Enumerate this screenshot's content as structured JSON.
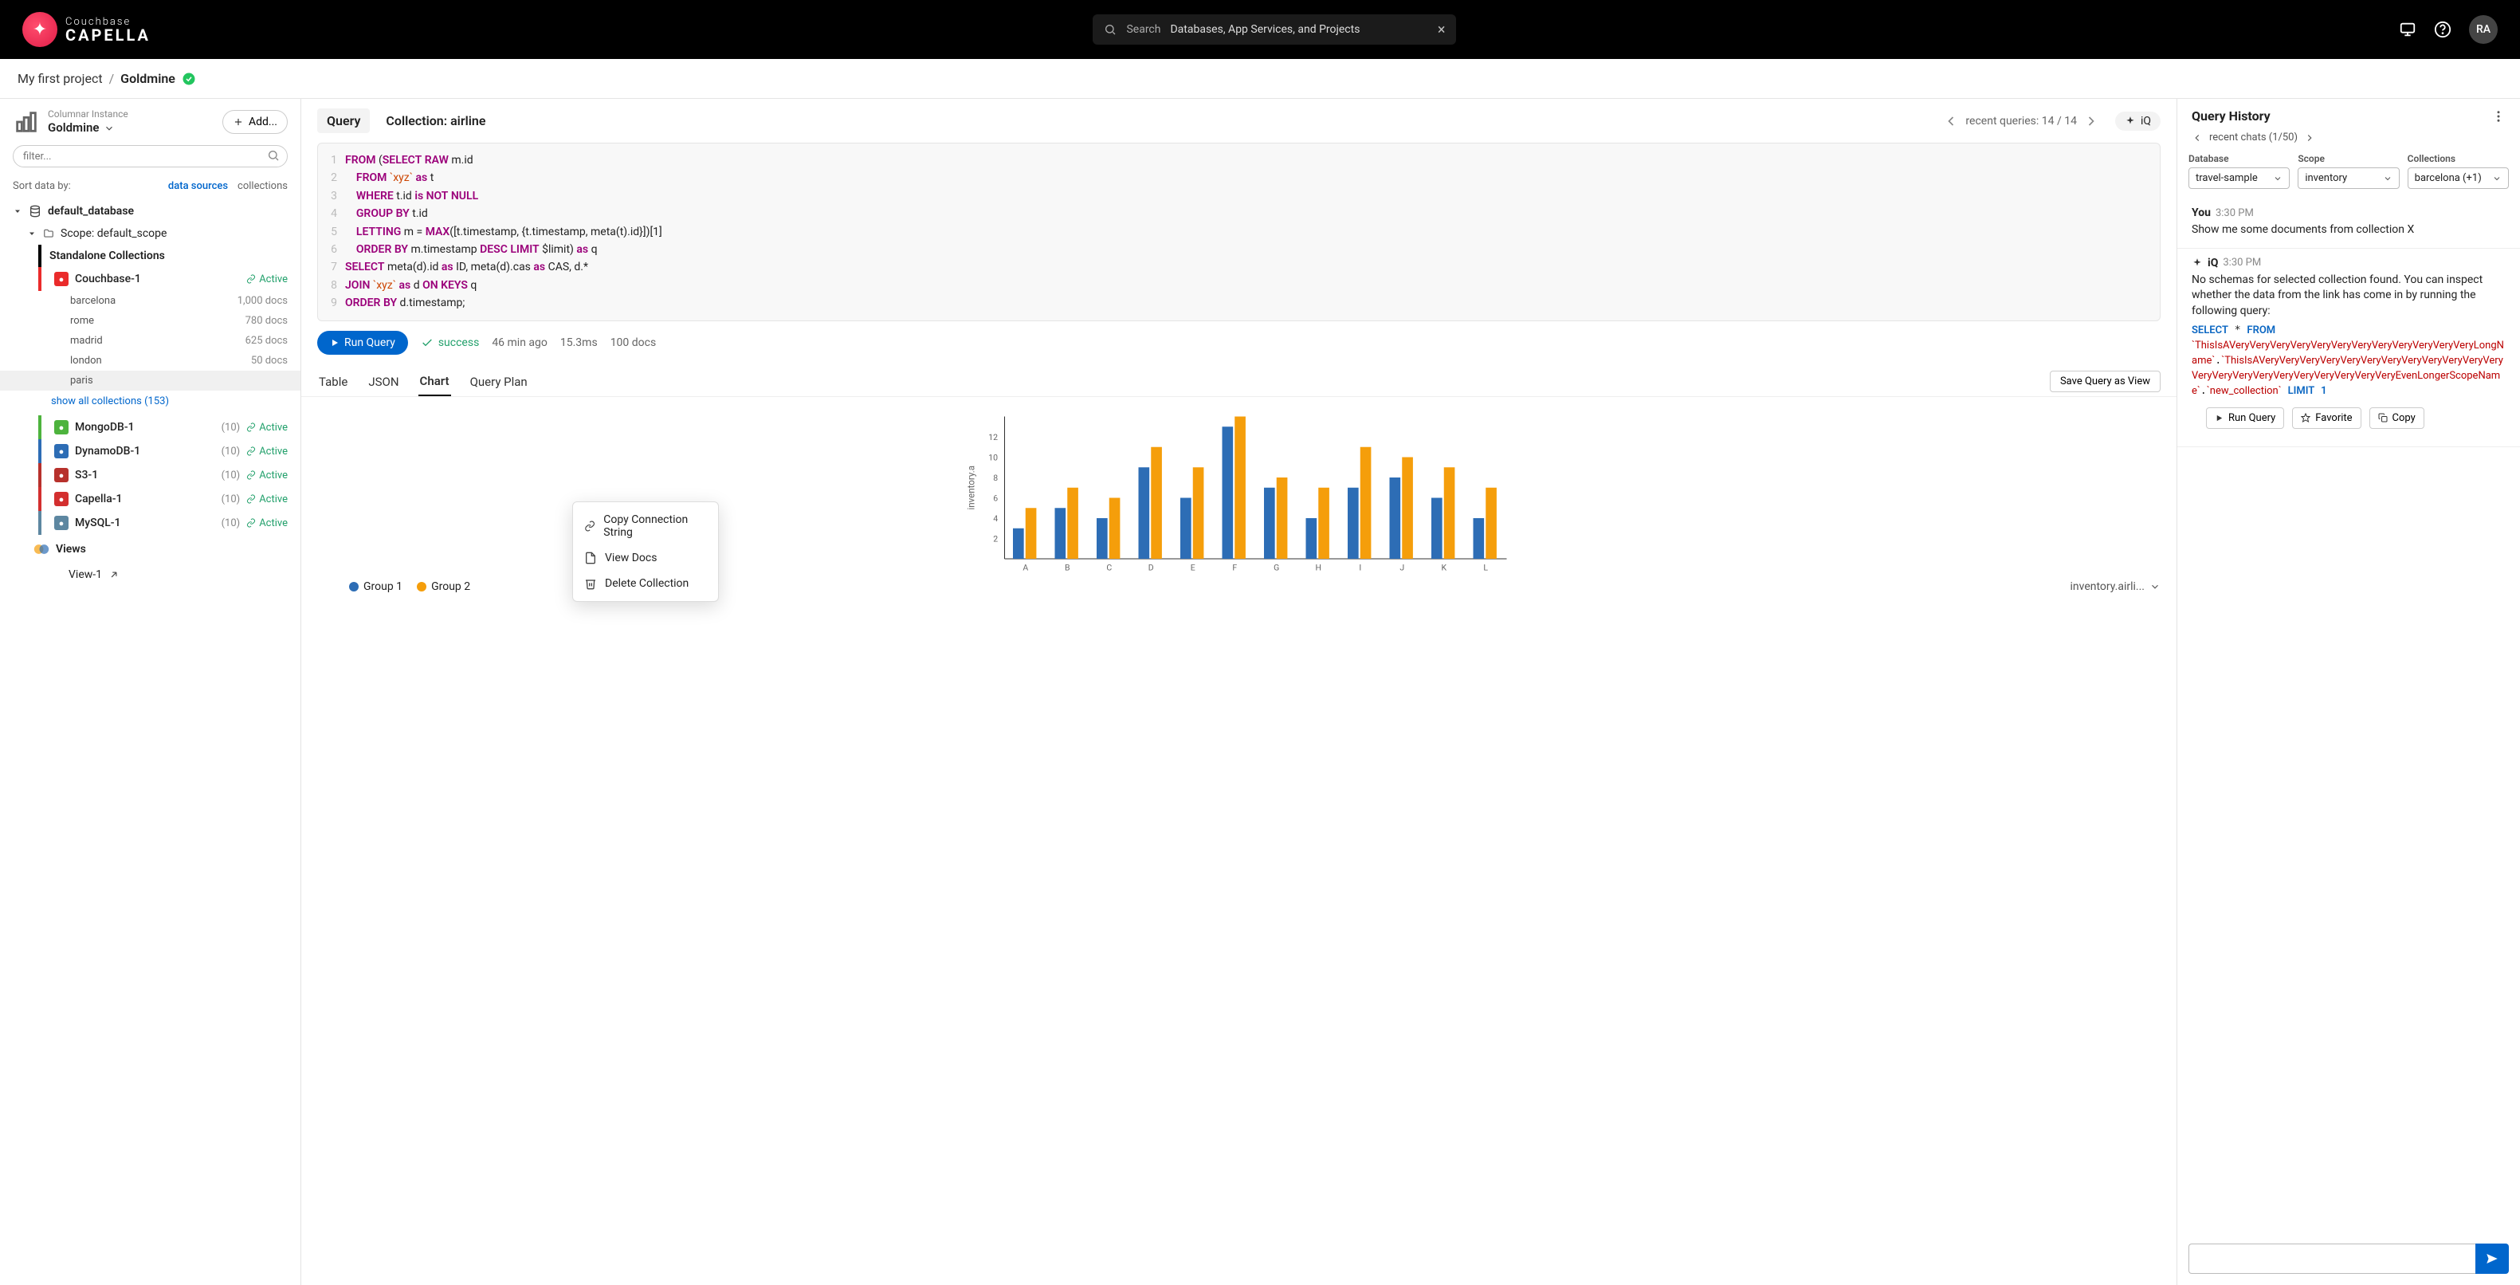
{
  "brand": {
    "line1": "Couchbase",
    "line2": "CAPELLA"
  },
  "search": {
    "label": "Search",
    "text": "Databases, App Services, and Projects"
  },
  "avatar": "RA",
  "crumbs": {
    "project": "My first project",
    "db": "Goldmine"
  },
  "sidebar": {
    "head_sub": "Columnar Instance",
    "head_name": "Goldmine",
    "add": "Add...",
    "filter_placeholder": "filter...",
    "sort_label": "Sort data by:",
    "sort_options": [
      "data sources",
      "collections"
    ],
    "default_db": "default_database",
    "scope": "Scope:  default_scope",
    "standalone": "Standalone Collections",
    "connections": [
      {
        "name": "Couchbase-1",
        "count": "",
        "status": "Active",
        "color": "#ea2b2b",
        "leaves": [
          {
            "name": "barcelona",
            "docs": "1,000 docs"
          },
          {
            "name": "rome",
            "docs": "780 docs"
          },
          {
            "name": "madrid",
            "docs": "625 docs"
          },
          {
            "name": "london",
            "docs": "50 docs"
          },
          {
            "name": "paris",
            "docs": ""
          }
        ],
        "showall": "show all collections (153)"
      },
      {
        "name": "MongoDB-1",
        "count": "(10)",
        "status": "Active",
        "color": "#4db33d"
      },
      {
        "name": "DynamoDB-1",
        "count": "(10)",
        "status": "Active",
        "color": "#2d6db5"
      },
      {
        "name": "S3-1",
        "count": "(10)",
        "status": "Active",
        "color": "#b7312c"
      },
      {
        "name": "Capella-1",
        "count": "(10)",
        "status": "Active",
        "color": "#d32f2f"
      },
      {
        "name": "MySQL-1",
        "count": "(10)",
        "status": "Active",
        "color": "#5d87a1"
      }
    ],
    "views": {
      "label": "Views",
      "items": [
        "View-1"
      ]
    }
  },
  "ctx_menu": [
    "Copy Connection String",
    "View Docs",
    "Delete Collection"
  ],
  "center": {
    "tab": "Query",
    "coll_label": "Collection: airline",
    "recent": "recent queries: 14 / 14",
    "iq": "iQ",
    "code": [
      {
        "n": "1",
        "raw": "FROM (SELECT RAW m.id"
      },
      {
        "n": "2",
        "raw": "    FROM `xyz` as t"
      },
      {
        "n": "3",
        "raw": "    WHERE t.id is NOT NULL"
      },
      {
        "n": "4",
        "raw": "    GROUP BY t.id"
      },
      {
        "n": "5",
        "raw": "    LETTING m = MAX([t.timestamp, {t.timestamp, meta(t).id}])[1]"
      },
      {
        "n": "6",
        "raw": "    ORDER BY m.timestamp DESC LIMIT $limit) as q"
      },
      {
        "n": "7",
        "raw": "SELECT meta(d).id as ID, meta(d).cas as CAS, d.*"
      },
      {
        "n": "8",
        "raw": "JOIN `xyz` as d ON KEYS q"
      },
      {
        "n": "9",
        "raw": "ORDER BY d.timestamp;"
      }
    ],
    "run": "Run Query",
    "success": "success",
    "ago": "46 min ago",
    "ms": "15.3ms",
    "docs": "100 docs",
    "result_tabs": [
      "Table",
      "JSON",
      "Chart",
      "Query Plan"
    ],
    "save": "Save Query as View",
    "legend": [
      "Group 1",
      "Group 2"
    ],
    "select_label": "inventory.airli..."
  },
  "right": {
    "title": "Query History",
    "recent": "recent chats (1/50)",
    "sels": [
      {
        "lbl": "Database",
        "val": "travel-sample"
      },
      {
        "lbl": "Scope",
        "val": "inventory"
      },
      {
        "lbl": "Collections",
        "val": "barcelona (+1)"
      }
    ],
    "msg1": {
      "who": "You",
      "when": "3:30 PM",
      "body": "Show me some documents from collection X"
    },
    "msg2": {
      "who": "iQ",
      "when": "3:30 PM",
      "body": "No schemas for selected collection found. You can inspect whether the data from the link has come in by running the following query:",
      "code": "SELECT * FROM\n`ThisIsAVeryVeryVeryVeryVeryVeryVeryVeryVeryVeryVeryVeryLongName`.`ThisIsAVeryVeryVeryVeryVeryVeryVeryVeryVeryVeryVeryVeryVeryVeryVeryVeryVeryVeryVeryVeryVeryVeryEvenLongerScopeName`.`new_collection` LIMIT 1"
    },
    "actions": [
      "Run Query",
      "Favorite",
      "Copy"
    ]
  },
  "chart_data": {
    "type": "bar",
    "categories": [
      "A",
      "B",
      "C",
      "D",
      "E",
      "F",
      "G",
      "H",
      "I",
      "J",
      "K",
      "L"
    ],
    "series": [
      {
        "name": "Group 1",
        "color": "#2d6db5",
        "values": [
          3,
          5,
          4,
          9,
          6,
          13,
          7,
          4,
          7,
          8,
          6,
          4
        ]
      },
      {
        "name": "Group 2",
        "color": "#f59e0b",
        "values": [
          5,
          7,
          6,
          11,
          9,
          14,
          8,
          7,
          11,
          10,
          9,
          7
        ]
      }
    ],
    "yticks": [
      2,
      4,
      6,
      8,
      10,
      12
    ],
    "ylabel": "inventory.a",
    "ylim": [
      0,
      14
    ]
  }
}
